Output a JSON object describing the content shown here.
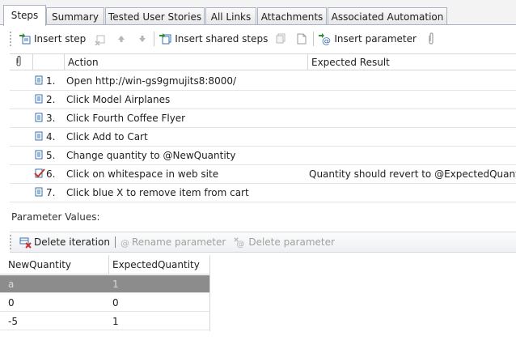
{
  "tabs": [
    {
      "label": "Steps",
      "active": true
    },
    {
      "label": "Summary",
      "active": false
    },
    {
      "label": "Tested User Stories",
      "active": false
    },
    {
      "label": "All Links",
      "active": false
    },
    {
      "label": "Attachments",
      "active": false
    },
    {
      "label": "Associated Automation",
      "active": false
    }
  ],
  "toolbar": {
    "insert_step": "Insert step",
    "insert_shared_steps": "Insert shared steps",
    "insert_parameter": "Insert parameter"
  },
  "grid": {
    "col_action": "Action",
    "col_expected": "Expected Result"
  },
  "steps": [
    {
      "num": "1.",
      "action": "Open http://win-gs9gmujits8:8000/",
      "expected": ""
    },
    {
      "num": "2.",
      "action": "Click Model Airplanes",
      "expected": ""
    },
    {
      "num": "3.",
      "action": "Click Fourth Coffee Flyer",
      "expected": ""
    },
    {
      "num": "4.",
      "action": "Click Add to Cart",
      "expected": ""
    },
    {
      "num": "5.",
      "action": "Change quantity to @NewQuantity",
      "expected": ""
    },
    {
      "num": "6.",
      "action": "Click on whitespace in web site",
      "expected": "Quantity should revert to @ExpectedQuantity"
    },
    {
      "num": "7.",
      "action": "Click blue X to remove item from cart",
      "expected": ""
    }
  ],
  "parameters": {
    "label": "Parameter Values:",
    "delete_iteration": "Delete iteration",
    "rename_parameter": "Rename parameter",
    "delete_parameter": "Delete parameter",
    "columns": [
      "NewQuantity",
      "ExpectedQuantity"
    ],
    "rows": [
      [
        "a",
        "1"
      ],
      [
        "0",
        "0"
      ],
      [
        "-5",
        "1"
      ]
    ]
  },
  "colors": {
    "selected_row": "#8c8c8c",
    "validated_check": "#c0392b"
  }
}
